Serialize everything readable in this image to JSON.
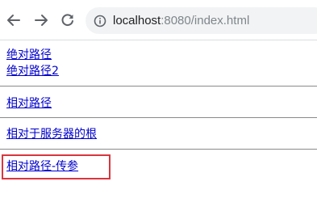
{
  "browser": {
    "back_icon": "arrow-left-icon",
    "forward_icon": "arrow-right-icon",
    "reload_icon": "reload-icon",
    "info_icon": "info-circle-icon",
    "url_host": "localhost",
    "url_rest": ":8080/index.html"
  },
  "page": {
    "links": [
      {
        "label": "绝对路径"
      },
      {
        "label": "绝对路径2"
      },
      {
        "label": "相对路径"
      },
      {
        "label": "相对于服务器的根"
      },
      {
        "label": "相对路径-传参"
      }
    ],
    "link_color": "#0000cc",
    "highlight_color": "#d9363e"
  }
}
